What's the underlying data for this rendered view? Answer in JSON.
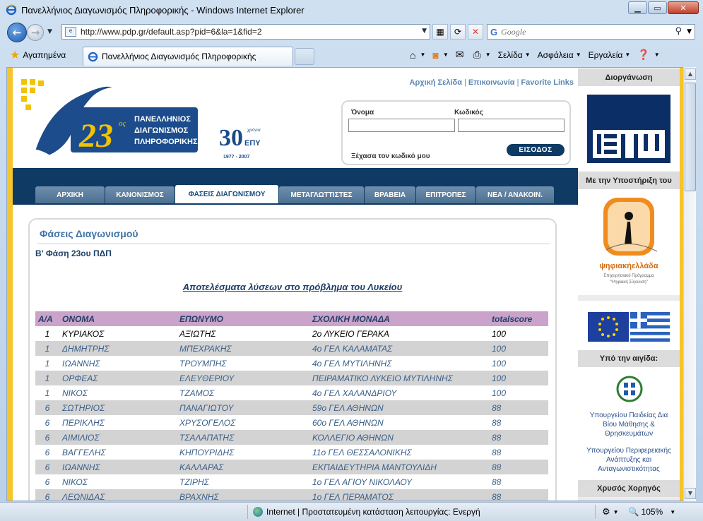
{
  "window": {
    "title": "Πανελλήνιος Διαγωνισμός Πληροφορικής - Windows Internet Explorer"
  },
  "address": {
    "url": "http://www.pdp.gr/default.asp?pid=6&la=1&fid=2"
  },
  "search": {
    "placeholder": "Google"
  },
  "favorites": {
    "label": "Αγαπημένα"
  },
  "tab": {
    "label": "Πανελλήνιος Διαγωνισμός Πληροφορικής"
  },
  "commands": {
    "page": "Σελίδα",
    "safety": "Ασφάλεια",
    "tools": "Εργαλεία"
  },
  "site": {
    "logo_line1": "ΠΑΝΕΛΛΗΝΙΟΣ",
    "logo_line2": "ΔΙΑΓΩΝΙΣΜΟΣ",
    "logo_line3": "ΠΛΗΡΟΦΟΡΙΚΗΣ",
    "logo_number": "23",
    "logo_sup": "ος",
    "years_number": "30",
    "years_sup": "χρόνια",
    "years_org": "ΕΠΥ",
    "years_range": "1977 - 2007",
    "toplinks": {
      "home": "Αρχική Σελίδα",
      "contact": "Επικοινωνία",
      "favorites": "Favorite Links"
    },
    "login": {
      "name_label": "Όνομα",
      "password_label": "Κωδικός",
      "forgot": "Ξέχασα τον κωδικό μου",
      "button": "ΕΙΣΟΔΟΣ"
    },
    "nav": [
      "ΑΡΧΙΚΗ",
      "ΚΑΝΟΝΙΣΜΟΣ",
      "ΦΑΣΕΙΣ ΔΙΑΓΩΝΙΣΜΟΥ",
      "ΜΕΤΑΓΛΩΤΤΙΣΤΕΣ",
      "ΒΡΑΒΕΙΑ",
      "ΕΠΙΤΡΟΠΕΣ",
      "ΝΕΑ / ΑΝΑΚΟΙΝ."
    ],
    "box_title": "Φάσεις Διαγωνισμού",
    "phase": "Β' Φάση 23ου ΠΔΠ",
    "results_link": "Αποτελέσματα λύσεων στο πρόβλημα του Λυκείου"
  },
  "table": {
    "headers": [
      "Α/Α",
      "ΟΝΟΜΑ",
      "ΕΠΩΝΥΜΟ",
      "ΣΧΟΛΙΚΗ ΜΟΝΑΔΑ",
      "totalscore"
    ],
    "rows": [
      [
        "1",
        "ΚΥΡΙΑΚΟΣ",
        "ΑΞΙΩΤΗΣ",
        "2ο ΛΥΚΕΙΟ ΓΕΡΑΚΑ",
        "100"
      ],
      [
        "1",
        "ΔΗΜΗΤΡΗΣ",
        "ΜΠΕΧΡΑΚΗΣ",
        "4ο ΓΕΛ ΚΑΛΑΜΑΤΑΣ",
        "100"
      ],
      [
        "1",
        "ΙΩΑΝΝΗΣ",
        "ΤΡΟΥΜΠΗΣ",
        "4ο ΓΕΛ ΜΥΤΙΛΗΝΗΣ",
        "100"
      ],
      [
        "1",
        "ΟΡΦΕΑΣ",
        "ΕΛΕΥΘΕΡΙΟΥ",
        "ΠΕΙΡΑΜΑΤΙΚΟ ΛΥΚΕΙΟ ΜΥΤΙΛΗΝΗΣ",
        "100"
      ],
      [
        "1",
        "ΝΙΚΟΣ",
        "ΤΖΑΜΟΣ",
        "4ο ΓΕΛ ΧΑΛΑΝΔΡΙΟΥ",
        "100"
      ],
      [
        "6",
        "ΣΩΤΗΡΙΟΣ",
        "ΠΑΝΑΓΙΩΤΟΥ",
        "59ο ΓΕΛ ΑΘΗΝΩΝ",
        "88"
      ],
      [
        "6",
        "ΠΕΡΙΚΛΗΣ",
        "ΧΡΥΣΟΓΕΛΟΣ",
        "60ο ΓΕΛ ΑΘΗΝΩΝ",
        "88"
      ],
      [
        "6",
        "ΑΙΜΙΛΙΟΣ",
        "ΤΣΑΛΑΠΑΤΗΣ",
        "ΚΟΛΛΕΓΙΟ ΑΘΗΝΩΝ",
        "88"
      ],
      [
        "6",
        "ΒΑΓΓΕΛΗΣ",
        "ΚΗΠΟΥΡΙΔΗΣ",
        "11ο ΓΕΛ ΘΕΣΣΑΛΟΝΙΚΗΣ",
        "88"
      ],
      [
        "6",
        "ΙΩΑΝΝΗΣ",
        "ΚΑΛΛΑΡΑΣ",
        "ΕΚΠΑΙΔΕΥΤΗΡΙΑ ΜΑΝΤΟΥΛΙΔΗ",
        "88"
      ],
      [
        "6",
        "ΝΙΚΟΣ",
        "ΤΖΙΡΗΣ",
        "1ο ΓΕΛ ΑΓΙΟΥ ΝΙΚΟΛΑΟΥ",
        "88"
      ],
      [
        "6",
        "ΛΕΩΝΙΔΑΣ",
        "ΒΡΑΧΝΗΣ",
        "1ο ΓΕΛ ΠΕΡΑΜΑΤΟΣ",
        "88"
      ]
    ]
  },
  "sidebar": {
    "organizer": "Διοργάνωση",
    "eth_logo_text": "ΕΠΥ",
    "support": "Με την Υποστήριξη του",
    "digital_name": "ψηφιακήελλάδα",
    "digital_sub1": "Επιχειρησιακό Πρόγραμμα",
    "digital_sub2": "\"Ψηφιακή Σύγκλιση\"",
    "auspices": "Υπό την αιγίδα:",
    "ministry1_line1": "Υπουργείου Παιδείας Δια",
    "ministry1_line2": "Βίου Μάθησης &",
    "ministry1_line3": "Θρησκευμάτων",
    "ministry2_line1": "Υπουργείου Περιφερειακής",
    "ministry2_line2": "Ανάπτυξης και",
    "ministry2_line3": "Ανταγωνιστικότητας",
    "gold_sponsor": "Χρυσός Χορηγός"
  },
  "status": {
    "zone": "Internet | Προστατευμένη κατάσταση λειτουργίας: Ενεργή",
    "zoom": "105%"
  }
}
